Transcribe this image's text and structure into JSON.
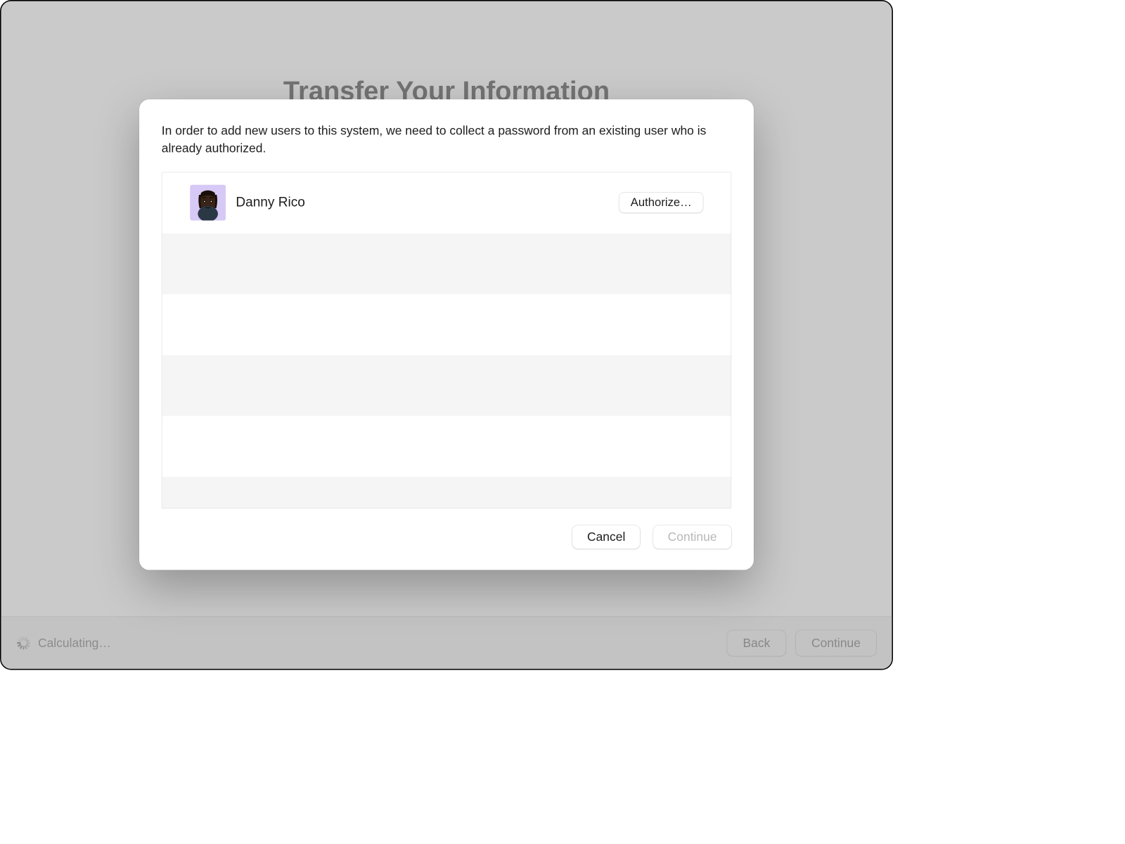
{
  "background": {
    "title": "Transfer Your Information"
  },
  "status": {
    "text": "Calculating…"
  },
  "bottomButtons": {
    "back": "Back",
    "continue": "Continue"
  },
  "modal": {
    "instruction": "In order to add new users to this system, we need to collect a password from an existing user who is already authorized.",
    "users": [
      {
        "name": "Danny Rico",
        "authorizeLabel": "Authorize…"
      }
    ],
    "cancel": "Cancel",
    "continue": "Continue"
  }
}
